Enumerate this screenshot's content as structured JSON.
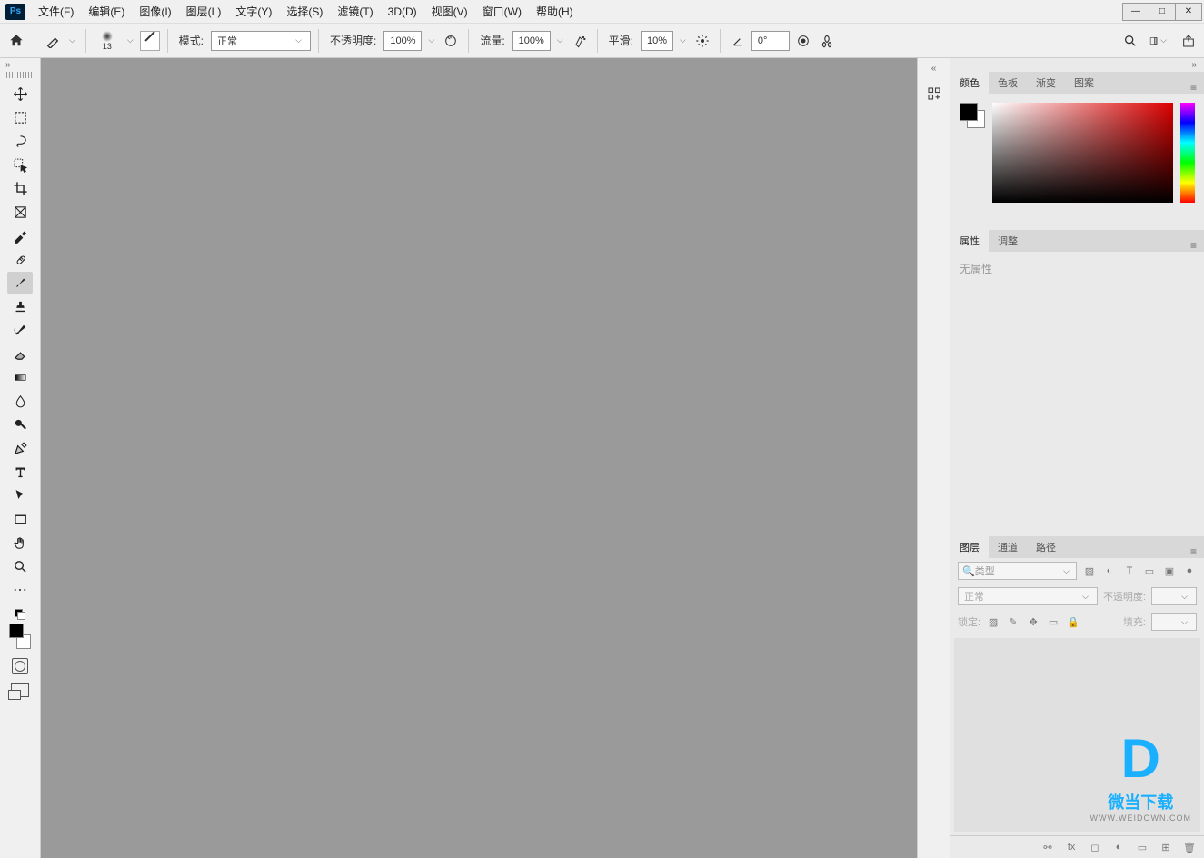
{
  "app": {
    "logo": "Ps"
  },
  "menu": [
    "文件(F)",
    "编辑(E)",
    "图像(I)",
    "图层(L)",
    "文字(Y)",
    "选择(S)",
    "滤镜(T)",
    "3D(D)",
    "视图(V)",
    "窗口(W)",
    "帮助(H)"
  ],
  "win_ctrl": {
    "min": "—",
    "max": "□",
    "close": "✕"
  },
  "optbar": {
    "brush_size": "13",
    "mode_label": "模式:",
    "mode_value": "正常",
    "opacity_label": "不透明度:",
    "opacity_value": "100%",
    "flow_label": "流量:",
    "flow_value": "100%",
    "smooth_label": "平滑:",
    "smooth_value": "10%",
    "angle_value": "0°"
  },
  "tools": [
    "move",
    "marquee",
    "lasso",
    "quick-select",
    "crop",
    "frame",
    "eyedropper",
    "heal",
    "brush",
    "stamp",
    "history-brush",
    "eraser",
    "gradient",
    "blur",
    "dodge",
    "pen",
    "type",
    "path-select",
    "rectangle",
    "hand",
    "zoom",
    "edit-toolbar"
  ],
  "color_tabs": [
    "颜色",
    "色板",
    "渐变",
    "图案"
  ],
  "prop_tabs": [
    "属性",
    "调整"
  ],
  "prop_body": "无属性",
  "layer_tabs": [
    "图层",
    "通道",
    "路径"
  ],
  "layers": {
    "filter_placeholder": "类型",
    "blend_value": "正常",
    "opacity_label": "不透明度:",
    "lock_label": "锁定:",
    "fill_label": "填充:"
  },
  "watermark": {
    "title": "微当下载",
    "url": "WWW.WEIDOWN.COM"
  }
}
